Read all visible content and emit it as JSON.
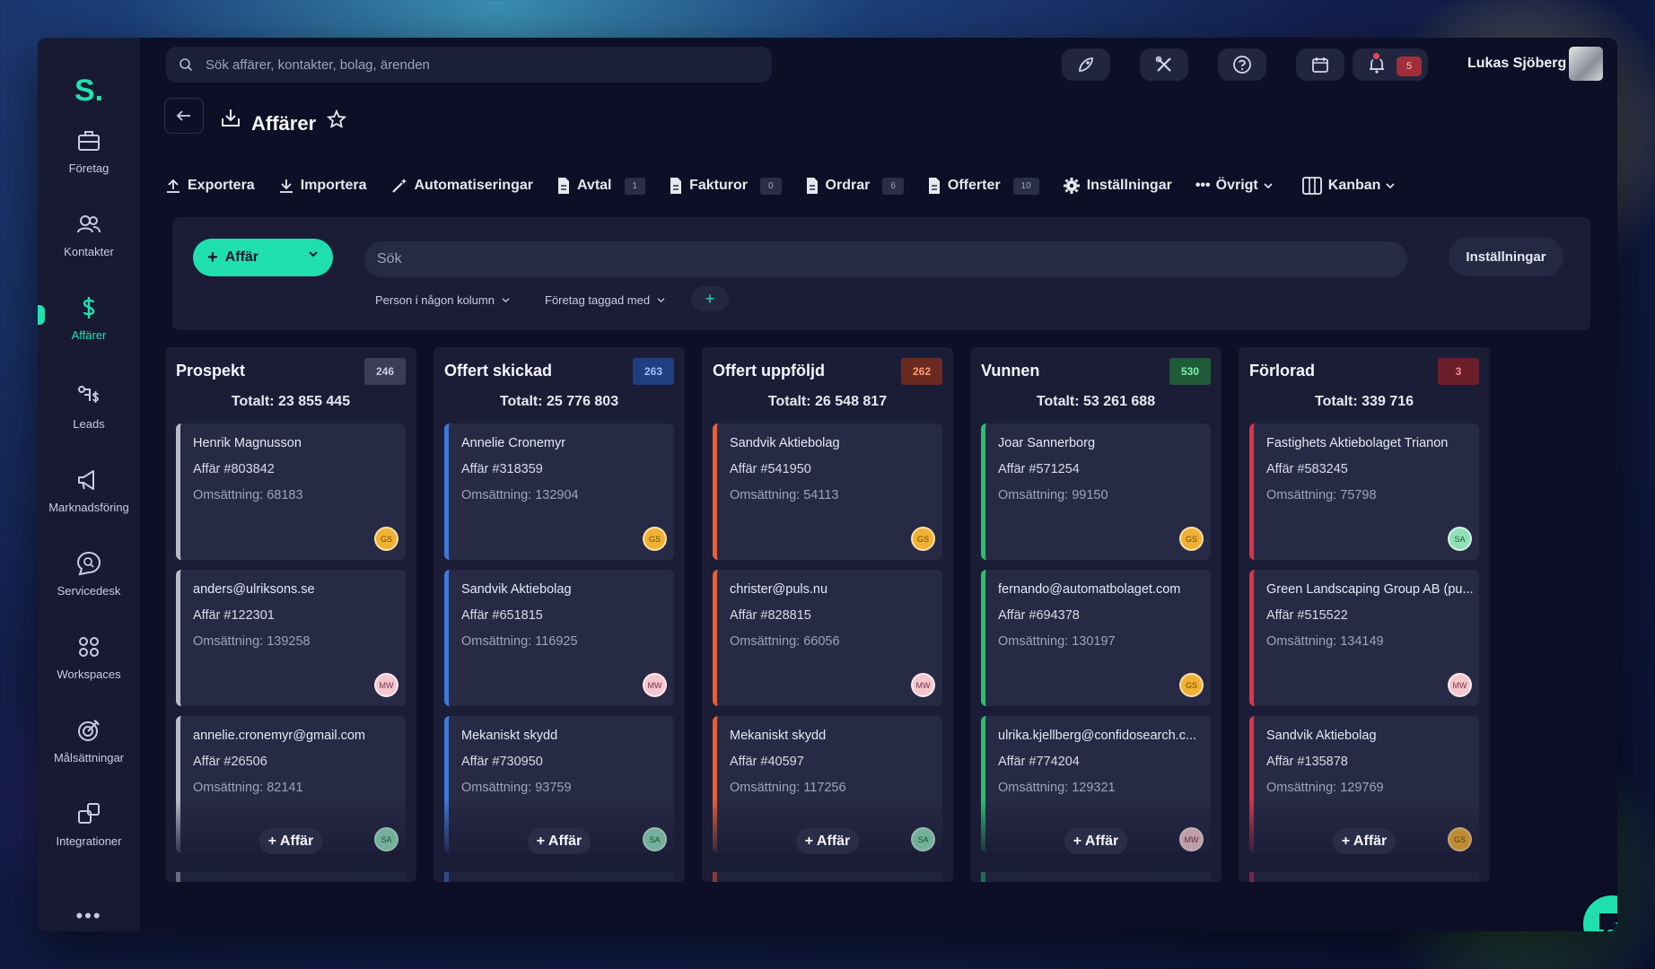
{
  "search_top": {
    "placeholder": "Sök affärer, kontakter, bolag, ärenden"
  },
  "user": {
    "name": "Lukas Sjöberg"
  },
  "notifications": {
    "count": "5"
  },
  "sidebar": {
    "logo": "S.",
    "items": [
      {
        "label": "Företag",
        "icon": "briefcase-icon"
      },
      {
        "label": "Kontakter",
        "icon": "contacts-icon"
      },
      {
        "label": "Affärer",
        "icon": "dollar-icon",
        "active": true
      },
      {
        "label": "Leads",
        "icon": "leads-icon"
      },
      {
        "label": "Marknadsföring",
        "icon": "megaphone-icon"
      },
      {
        "label": "Servicedesk",
        "icon": "chat-search-icon"
      },
      {
        "label": "Workspaces",
        "icon": "workspaces-icon"
      },
      {
        "label": "Målsättningar",
        "icon": "target-icon"
      },
      {
        "label": "Integrationer",
        "icon": "integrations-icon"
      }
    ],
    "more": "•••"
  },
  "header": {
    "title": "Affärer"
  },
  "toolbar": {
    "export": "Exportera",
    "import": "Importera",
    "automations": "Automatiseringar",
    "contracts": "Avtal",
    "contracts_count": "1",
    "invoices": "Fakturor",
    "invoices_count": "0",
    "orders": "Ordrar",
    "orders_count": "6",
    "offers": "Offerter",
    "offers_count": "10",
    "settings": "Inställningar",
    "other": "Övrigt",
    "view": "Kanban"
  },
  "filters": {
    "add_deal": "Affär",
    "search_placeholder": "Sök",
    "settings": "Inställningar",
    "chip1": "Person i någon kolumn",
    "chip2": "Företag taggad med",
    "add": "+"
  },
  "columns": [
    {
      "title": "Prospekt",
      "count": "246",
      "total": "Totalt: 23 855 445",
      "accent": "#b9bbc6",
      "count_bg": "#3a3d55",
      "count_fg": "#c9cbe0",
      "cards": [
        {
          "name": "Henrik Magnusson",
          "deal": "Affär #803842",
          "revenue": "Omsättning: 68183",
          "owner": "GS"
        },
        {
          "name": "anders@ulriksons.se",
          "deal": "Affär #122301",
          "revenue": "Omsättning: 139258",
          "owner": "MW"
        },
        {
          "name": "annelie.cronemyr@gmail.com",
          "deal": "Affär #26506",
          "revenue": "Omsättning: 82141",
          "owner": "SA"
        }
      ],
      "add_label": "+ Affär"
    },
    {
      "title": "Offert skickad",
      "count": "263",
      "total": "Totalt: 25 776 803",
      "accent": "#3f78d8",
      "count_bg": "#1f3f80",
      "count_fg": "#9ec0ff",
      "cards": [
        {
          "name": "Annelie Cronemyr",
          "deal": "Affär #318359",
          "revenue": "Omsättning: 132904",
          "owner": "GS"
        },
        {
          "name": "Sandvik Aktiebolag",
          "deal": "Affär #651815",
          "revenue": "Omsättning: 116925",
          "owner": "MW"
        },
        {
          "name": "Mekaniskt skydd",
          "deal": "Affär #730950",
          "revenue": "Omsättning: 93759",
          "owner": "SA"
        }
      ],
      "add_label": "+ Affär"
    },
    {
      "title": "Offert uppföljd",
      "count": "262",
      "total": "Totalt: 26 548 817",
      "accent": "#e3603a",
      "count_bg": "#6a2a1f",
      "count_fg": "#ff9a7a",
      "cards": [
        {
          "name": "Sandvik Aktiebolag",
          "deal": "Affär #541950",
          "revenue": "Omsättning: 54113",
          "owner": "GS"
        },
        {
          "name": "christer@puls.nu",
          "deal": "Affär #828815",
          "revenue": "Omsättning: 66056",
          "owner": "MW"
        },
        {
          "name": "Mekaniskt skydd",
          "deal": "Affär #40597",
          "revenue": "Omsättning: 117256",
          "owner": "SA"
        }
      ],
      "add_label": "+ Affär"
    },
    {
      "title": "Vunnen",
      "count": "530",
      "total": "Totalt: 53 261 688",
      "accent": "#2dbf6e",
      "count_bg": "#1f5a39",
      "count_fg": "#7ef0ae",
      "cards": [
        {
          "name": "Joar Sannerborg",
          "deal": "Affär #571254",
          "revenue": "Omsättning: 99150",
          "owner": "GS"
        },
        {
          "name": "fernando@automatbolaget.com",
          "deal": "Affär #694378",
          "revenue": "Omsättning: 130197",
          "owner": "GS"
        },
        {
          "name": "ulrika.kjellberg@confidosearch.c...",
          "deal": "Affär #774204",
          "revenue": "Omsättning: 129321",
          "owner": "MW"
        }
      ],
      "add_label": "+ Affär"
    },
    {
      "title": "Förlorad",
      "count": "3",
      "total": "Totalt: 339 716",
      "accent": "#d8354a",
      "count_bg": "#6a1f2a",
      "count_fg": "#ff8a98",
      "cards": [
        {
          "name": "Fastighets Aktiebolaget Trianon",
          "deal": "Affär #583245",
          "revenue": "Omsättning: 75798",
          "owner": "SA"
        },
        {
          "name": "Green Landscaping Group AB (pu...",
          "deal": "Affär #515522",
          "revenue": "Omsättning: 134149",
          "owner": "MW"
        },
        {
          "name": "Sandvik Aktiebolag",
          "deal": "Affär #135878",
          "revenue": "Omsättning: 129769",
          "owner": "GS"
        }
      ],
      "add_label": "+ Affär"
    }
  ],
  "owner_colors": {
    "GS": {
      "bg": "#f2b134",
      "fg": "#6b4a00"
    },
    "MW": {
      "bg": "#f4c7cf",
      "fg": "#7a3140"
    },
    "SA": {
      "bg": "#8fe0b8",
      "fg": "#1b5a3c"
    }
  }
}
